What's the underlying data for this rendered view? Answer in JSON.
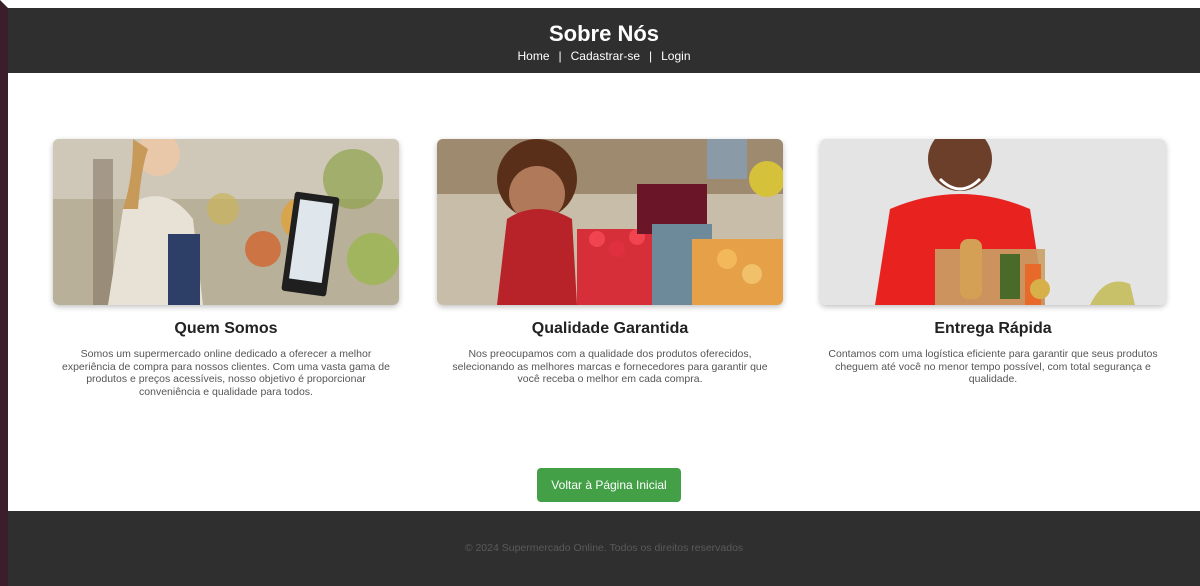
{
  "header": {
    "title": "Sobre Nós",
    "nav": [
      {
        "label": "Home"
      },
      {
        "label": "Cadastrar-se"
      },
      {
        "label": "Login"
      }
    ],
    "separator": "|"
  },
  "cards": [
    {
      "title": "Quem Somos",
      "text": "Somos um supermercado online dedicado a oferecer a melhor experiência de compra para nossos clientes. Com uma vasta gama de produtos e preços acessíveis, nosso objetivo é proporcionar conveniência e qualidade para todos."
    },
    {
      "title": "Qualidade Garantida",
      "text": "Nos preocupamos com a qualidade dos produtos oferecidos, selecionando as melhores marcas e fornecedores para garantir que você receba o melhor em cada compra."
    },
    {
      "title": "Entrega Rápida",
      "text": "Contamos com uma logística eficiente para garantir que seus produtos cheguem até você no menor tempo possível, com total segurança e qualidade."
    }
  ],
  "main": {
    "back_button": "Voltar à Página Inicial"
  },
  "footer": {
    "text": "© 2024 Supermercado Online. Todos os direitos reservados"
  },
  "colors": {
    "header_bg": "#2f2f2f",
    "button_bg": "#43a047",
    "footer_bg": "#2f2f2f"
  }
}
